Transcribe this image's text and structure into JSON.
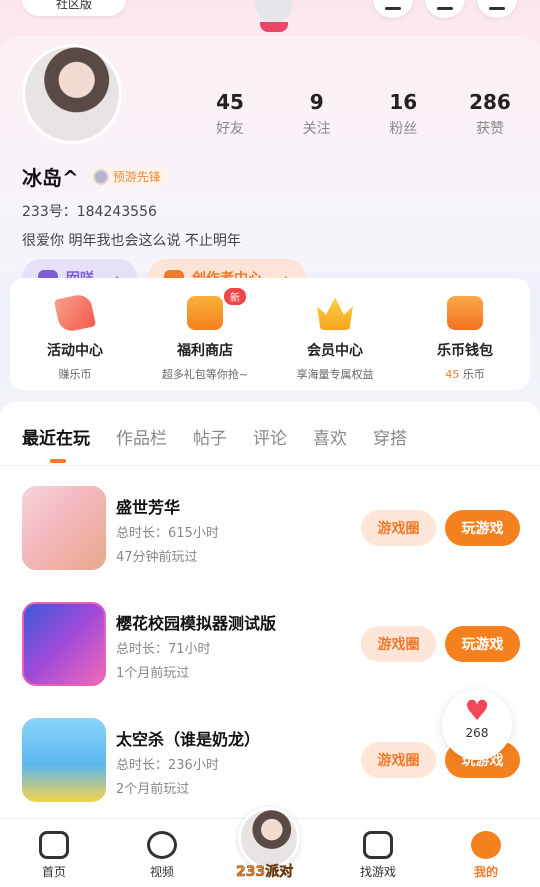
{
  "top": {
    "pill_label": "社区版"
  },
  "profile": {
    "name": "冰岛^",
    "badge": "预游先锋",
    "uid": "233号：184243556",
    "bio": "很爱你 明年我也会这么说 不止明年",
    "stats": [
      {
        "num": "45",
        "label": "好友"
      },
      {
        "num": "9",
        "label": "关注"
      },
      {
        "num": "16",
        "label": "粉丝"
      },
      {
        "num": "286",
        "label": "获赞"
      }
    ],
    "pill_left": "囡咩",
    "pill_right": "创作者中心"
  },
  "services": [
    {
      "title": "活动中心",
      "sub": "赚乐币",
      "icon": "party-icon",
      "color": "#f55a4e"
    },
    {
      "title": "福利商店",
      "sub": "超多礼包等你抢~",
      "icon": "shop-icon",
      "color": "#f5801e",
      "tag": "新"
    },
    {
      "title": "会员中心",
      "sub": "享海量专属权益",
      "icon": "crown-icon",
      "color": "#f7b21e"
    },
    {
      "title": "乐币钱包",
      "sub_num": "45",
      "sub_unit": " 乐币",
      "icon": "wallet-icon",
      "color": "#f5801e"
    }
  ],
  "tabs": [
    "最近在玩",
    "作品栏",
    "帖子",
    "评论",
    "喜欢",
    "穿搭"
  ],
  "games": [
    {
      "title": "盛世芳华",
      "time": "总时长：615小时",
      "last": "47分钟前玩过",
      "circle_btn": "游戏圈",
      "play_btn": "玩游戏"
    },
    {
      "title": "樱花校园模拟器测试版",
      "time": "总时长：71小时",
      "last": "1个月前玩过",
      "circle_btn": "游戏圈",
      "play_btn": "玩游戏"
    },
    {
      "title": "太空杀（谁是奶龙）",
      "time": "总时长：236小时",
      "last": "2个月前玩过",
      "circle_btn": "游戏圈",
      "play_btn": "玩游戏"
    }
  ],
  "floating_like": {
    "count": "268"
  },
  "nav": {
    "home": "首页",
    "video": "视频",
    "party": "233派对",
    "find": "找游戏",
    "mine": "我的"
  }
}
